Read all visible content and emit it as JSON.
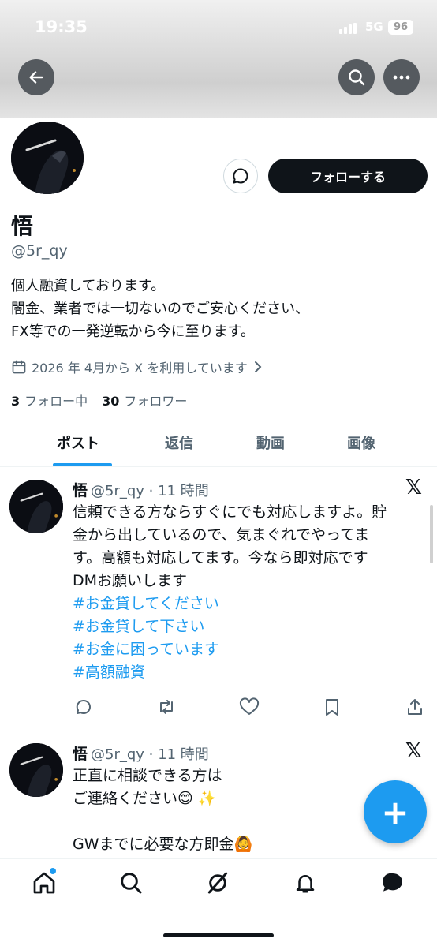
{
  "status_bar": {
    "time": "19:35",
    "network": "5G",
    "battery": "96"
  },
  "profile": {
    "follow_label": "フォローする",
    "display_name": "悟",
    "handle": "@5r_qy",
    "bio": [
      "個人融資しております。",
      "闇金、業者では一切ないのでご安心ください、",
      "FX等での一発逆転から今に至ります。"
    ],
    "joined": "2026 年 4月から X を利用しています",
    "following_count": "3",
    "following_label": "フォロー中",
    "followers_count": "30",
    "followers_label": "フォロワー"
  },
  "tabs": [
    "ポスト",
    "返信",
    "動画",
    "画像"
  ],
  "posts": [
    {
      "name": "悟",
      "meta": "@5r_qy · 11 時間",
      "text": [
        "信頼できる方ならすぐにでも対応しますよ。貯",
        "金から出しているので、気まぐれでやってま",
        "す。高額も対応してます。今なら即対応です",
        "DMお願いします"
      ],
      "hashtags": [
        "#お金貸してください",
        "#お金貸して下さい",
        "#お金に困っています",
        "#高額融資"
      ]
    },
    {
      "name": "悟",
      "meta": "@5r_qy · 11 時間",
      "text": [
        "正直に相談できる方は",
        "ご連絡ください😊 ✨",
        "",
        "GWまでに必要な方即金🙆"
      ]
    }
  ],
  "fab_label": "+",
  "icons": [
    "back-icon",
    "search-icon",
    "more-icon",
    "message-icon",
    "calendar-icon",
    "x-logo-icon",
    "reply-icon",
    "repost-icon",
    "like-icon",
    "bookmark-icon",
    "share-icon",
    "home-icon",
    "explore-icon",
    "grok-icon",
    "notifications-icon",
    "messages-icon"
  ],
  "colors": {
    "accent": "#1d9bf0",
    "text": "#0f1419",
    "muted": "#536471"
  }
}
